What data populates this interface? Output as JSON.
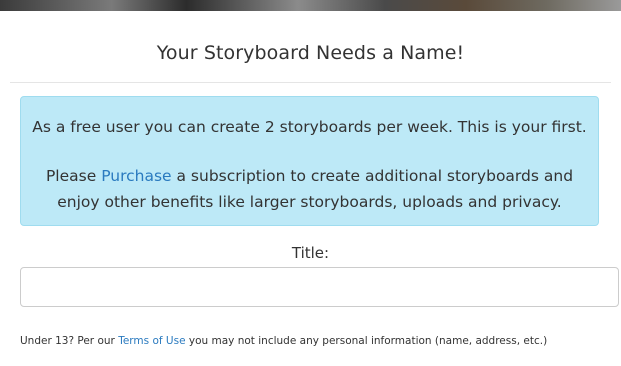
{
  "dialog": {
    "title": "Your Storyboard Needs a Name!"
  },
  "notice": {
    "line1": "As a free user you can create 2 storyboards per week. This is your first.",
    "line2_before": "Please ",
    "line2_link": "Purchase",
    "line2_after": " a subscription to create additional storyboards and enjoy other benefits like larger storyboards, uploads and privacy."
  },
  "form": {
    "title_label": "Title:",
    "title_value": "",
    "title_placeholder": ""
  },
  "footer": {
    "before": "Under 13? Per our ",
    "link": "Terms of Use",
    "after": " you may not include any personal information (name, address, etc.)"
  },
  "colors": {
    "notice_bg": "#bde9f7",
    "link": "#2a7abf"
  }
}
